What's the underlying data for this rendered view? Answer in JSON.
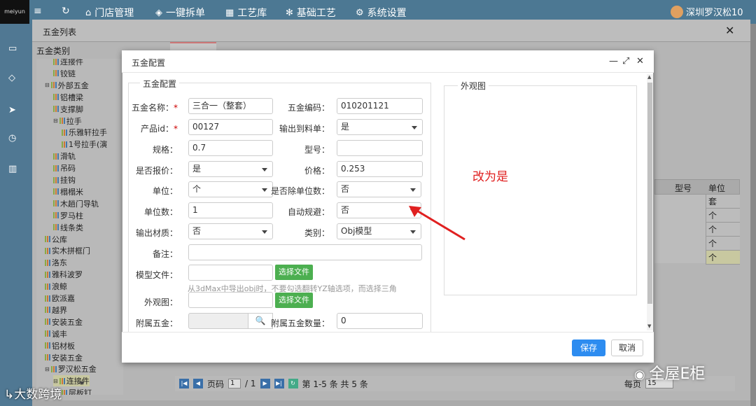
{
  "nav": {
    "logo": "meiyun",
    "items": [
      "门店管理",
      "一键拆单",
      "工艺库",
      "基础工艺",
      "系统设置"
    ],
    "user": "深圳罗汉松10"
  },
  "bg_window": {
    "title": "五金列表",
    "category_header": "五金类别",
    "tree": [
      {
        "label": "连接件",
        "indent": 1,
        "expander": false
      },
      {
        "label": "铰链",
        "indent": 1,
        "expander": false
      },
      {
        "label": "外部五金",
        "indent": 0,
        "expander": true
      },
      {
        "label": "铝槽梁",
        "indent": 1,
        "expander": false
      },
      {
        "label": "支撑脚",
        "indent": 1,
        "expander": false
      },
      {
        "label": "拉手",
        "indent": 1,
        "expander": true
      },
      {
        "label": "乐雅轩拉手",
        "indent": 2,
        "expander": false
      },
      {
        "label": "1号拉手(演",
        "indent": 2,
        "expander": false
      },
      {
        "label": "滑轨",
        "indent": 1,
        "expander": false
      },
      {
        "label": "吊码",
        "indent": 1,
        "expander": false
      },
      {
        "label": "挂钩",
        "indent": 1,
        "expander": false
      },
      {
        "label": "榻榻米",
        "indent": 1,
        "expander": false
      },
      {
        "label": "木趟门导轨",
        "indent": 1,
        "expander": false
      },
      {
        "label": "罗马柱",
        "indent": 1,
        "expander": false
      },
      {
        "label": "线条类",
        "indent": 1,
        "expander": false
      },
      {
        "label": "公库",
        "indent": 0,
        "expander": false
      },
      {
        "label": "实木拼框门",
        "indent": 0,
        "expander": false
      },
      {
        "label": "洛东",
        "indent": 0,
        "expander": false
      },
      {
        "label": "雅科波罗",
        "indent": 0,
        "expander": false
      },
      {
        "label": "浪鲸",
        "indent": 0,
        "expander": false
      },
      {
        "label": "欧派嘉",
        "indent": 0,
        "expander": false
      },
      {
        "label": "越界",
        "indent": 0,
        "expander": false
      },
      {
        "label": "安装五金",
        "indent": 0,
        "expander": false
      },
      {
        "label": "诚丰",
        "indent": 0,
        "expander": false
      },
      {
        "label": "铝材板",
        "indent": 0,
        "expander": false
      },
      {
        "label": "安装五金",
        "indent": 0,
        "expander": false
      },
      {
        "label": "罗汉松五金",
        "indent": 0,
        "expander": true
      },
      {
        "label": "连接件",
        "indent": 1,
        "expander": true
      },
      {
        "label": "层板钉",
        "indent": 2,
        "expander": false
      }
    ],
    "grid_headers": [
      "型号",
      "单位"
    ],
    "grid_units": [
      "套",
      "个",
      "个",
      "个",
      "个"
    ],
    "pager": {
      "page_label": "页码",
      "page": "1",
      "total_pages": "/ 1",
      "summary": "第 1-5 条  共 5 条",
      "per_page_label": "每页",
      "per_page": "15"
    }
  },
  "modal": {
    "title": "五金配置",
    "section_title": "五金配置",
    "fields": {
      "name_label": "五金名称：",
      "name_value": "三合一（整套）",
      "code_label": "五金编码：",
      "code_value": "010201121",
      "pid_label": "产品id：",
      "pid_value": "00127",
      "output_label": "输出到料单：",
      "output_value": "是",
      "spec_label": "规格：",
      "spec_value": "0.7",
      "model_label": "型号：",
      "model_value": "",
      "quote_label": "是否报价：",
      "quote_value": "是",
      "price_label": "价格：",
      "price_value": "0.253",
      "unit_label": "单位：",
      "unit_value": "个",
      "divide_label": "是否除单位数：",
      "divide_value": "否",
      "unitnum_label": "单位数：",
      "unitnum_value": "1",
      "avoid_label": "自动规避：",
      "avoid_value": "否",
      "material_label": "输出材质：",
      "material_value": "否",
      "category_label": "类别：",
      "category_value": "Obj模型",
      "remark_label": "备注：",
      "remark_value": "",
      "modelfile_label": "模型文件：",
      "modelfile_value": "",
      "file_btn": "选择文件",
      "hint": "从3dMax中导出obj时，不要勾选翻转YZ轴选项，而选择三角",
      "appearance_label": "外观图：",
      "appearance_value": "",
      "attach_label": "附属五金：",
      "attachnum_label": "附属五金数量：",
      "attachnum_value": "0"
    },
    "appearance_section": "外观图",
    "annotation": "改为是",
    "save": "保存",
    "cancel": "取消"
  },
  "watermarks": {
    "left": "大数跨境",
    "right": "全屋E柜"
  },
  "colors": {
    "primary": "#2d8cf0",
    "file_button": "#4caf50",
    "annotation": "#e02020"
  }
}
